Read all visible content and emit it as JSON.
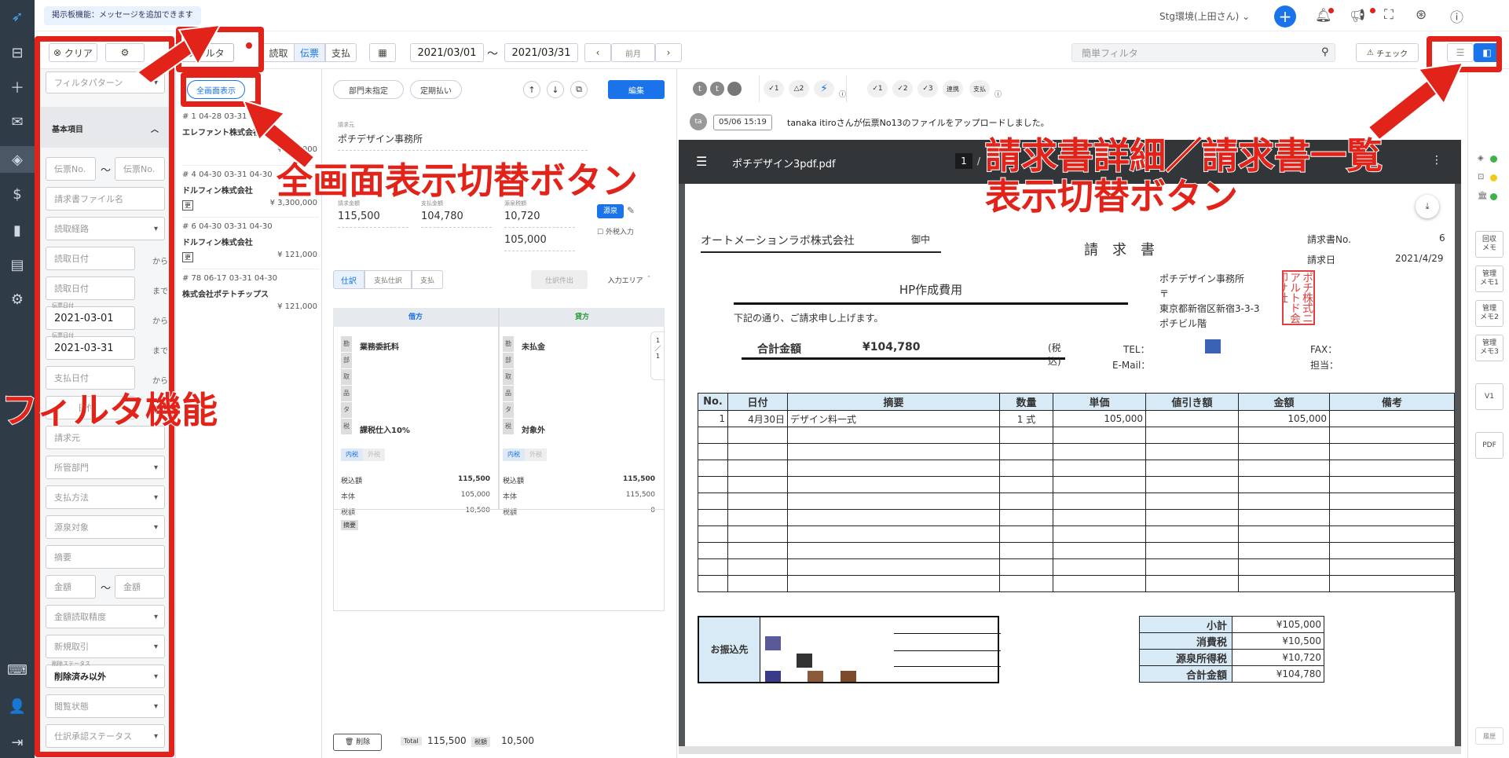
{
  "topbar": {
    "notice": "掲示板機能：メッセージを追加できます",
    "user": "Stg環境(上田さん) ⌄"
  },
  "toolbar": {
    "clear": "クリア",
    "filter": "フィルタ",
    "tab_read": "読取",
    "tab_voucher": "伝票",
    "tab_pay": "支払",
    "date_from": "2021/03/01",
    "date_sep": "〜",
    "date_to": "2021/03/31",
    "prev_month": "前月",
    "quick_filter_placeholder": "簡単フィルタ",
    "check": "チェック"
  },
  "filters": {
    "pattern": "フィルタパターン",
    "section": "基本項目",
    "voucher_no_a": "伝票No.",
    "voucher_no_b": "伝票No.",
    "file_name": "請求書ファイル名",
    "route": "読取経路",
    "read_date_a": "読取日付",
    "read_date_b": "読取日付",
    "from": "から",
    "to": "まで",
    "voucher_date_label": "伝票日付",
    "voucher_date_a": "2021-03-01",
    "voucher_date_b": "2021-03-31",
    "pay_date_a": "支払日付",
    "pay_date_b_partial": "日付",
    "biller": "請求元",
    "dept": "所管部門",
    "pay_method": "支払方法",
    "withholding": "源泉対象",
    "summary": "摘要",
    "amount_a": "金額",
    "amount_b": "金額",
    "accuracy": "金額読取精度",
    "new_trade": "新規取引",
    "delete_status_label": "削除ステータス",
    "delete_status": "削除済み以外",
    "view_state": "閲覧状態",
    "approval": "仕訳承認ステータス"
  },
  "list": {
    "fullscreen": "全画面表示",
    "items": [
      {
        "meta": "# 1   04-28   03-31   04-30",
        "name": "エレファント株式会社",
        "amount": "¥ 165,000"
      },
      {
        "meta": "# 4   04-30   03-31   04-30",
        "name": "ドルフィン株式会社",
        "tag": "更",
        "amount": "¥ 3,300,000"
      },
      {
        "meta": "# 6   04-30   03-31   04-30",
        "name": "ドルフィン株式会社",
        "tag": "更",
        "amount": "¥ 121,000"
      },
      {
        "meta": "# 78   06-17   03-31   04-30",
        "name": "株式会社ポテトチップス",
        "amount": "¥ 121,000"
      }
    ]
  },
  "entry": {
    "dept_unset": "部門未指定",
    "regular": "定期払い",
    "save": "編集",
    "biller_label": "請求元",
    "biller": "ポチデザイン事務所",
    "billed_label": "請求金額",
    "billed": "115,500",
    "paid_label": "支払金額",
    "paid": "104,780",
    "wh_label": "源泉税額",
    "wh": "10,720",
    "wh_base": "105,000",
    "wh_badge": "源泉",
    "tax_exempt": "外税入力",
    "tab_journal": "仕訳",
    "tab_pay_journal": "支払仕訳",
    "tab_pay": "支払",
    "journal_out": "仕訳件出",
    "input_area": "入力エリア ＾",
    "debit": "借方",
    "credit": "貸方",
    "row_labels": [
      "勘",
      "部",
      "取",
      "品",
      "タ",
      "税"
    ],
    "debit_account": "業務委託料",
    "debit_tax": "課税仕入10%",
    "credit_account": "未払金",
    "credit_tax": "対象外",
    "inner_tax": "内税",
    "outer_tax": "外税",
    "incl_label": "税込額",
    "base_label": "本体",
    "tax_label": "税額",
    "debit_incl": "115,500",
    "debit_base": "105,000",
    "debit_tax_amt": "10,500",
    "credit_incl": "115,500",
    "credit_base": "115,500",
    "credit_tax_amt": "0",
    "memo": "摘要",
    "delete": "削除",
    "total_label": "Total",
    "total": "115,500",
    "tax_tot_label": "税額",
    "tax_total": "10,500",
    "side_numbers": "1\n／\n1"
  },
  "viewer": {
    "badges1": [
      "1",
      "2"
    ],
    "badges2": [
      "1",
      "2",
      "3"
    ],
    "linked": "連携",
    "pay": "支払",
    "avatar": "ta",
    "log_time": "05/06 15:19",
    "log_msg": "tanaka itiroさんが伝票No13のファイルをアップロードしました。",
    "pdf_name": "ポチデザイン3pdf.pdf",
    "page": "1",
    "page_sep": "/"
  },
  "invoice": {
    "to_company": "オートメーションラボ株式会社",
    "honorific": "御中",
    "title": "請　求　書",
    "no_label": "請求書No.",
    "no": "6",
    "date_label": "請求日",
    "date": "2021/4/29",
    "subject": "HP作成費用",
    "intro": "下記の通り、ご請求申し上げます。",
    "total_label": "合計金額",
    "total": "¥104,780",
    "tax_note": "(税込)",
    "from_name": "ポチデザイン事務所",
    "postal": "〒",
    "address": "東京都新宿区新宿3-3-3",
    "building": "ポチビル階",
    "tel": "TEL：",
    "fax": "FAX：",
    "email": "E-Mail：",
    "contact": "担当：",
    "seal": "ポチ株式ニアルトド会印サ社",
    "headers": [
      "No.",
      "日付",
      "摘要",
      "数量",
      "単価",
      "値引き額",
      "金額",
      "備考"
    ],
    "row1": [
      "1",
      "4月30日",
      "デザイン料一式",
      "1 式",
      "105,000",
      "",
      "105,000",
      ""
    ],
    "bank_label": "お振込先",
    "subtotal_label": "小計",
    "subtotal": "¥105,000",
    "ctax_label": "消費税",
    "ctax": "¥10,500",
    "wh_label": "源泉所得税",
    "wh": "¥10,720",
    "grand_label": "合計金額",
    "grand": "¥104,780"
  },
  "rail": {
    "collect_memo": "回収\nメモ",
    "memo1": "管理\nメモ1",
    "memo2": "管理\nメモ2",
    "memo3": "管理\nメモ3",
    "v1": "V1",
    "pdf": "PDF",
    "history": "履歴"
  },
  "annotations": {
    "fullscreen_toggle": "全画面表示切替ボタン",
    "detail_list_toggle_1": "請求書詳細／請求書一覧",
    "detail_list_toggle_2": "表示切替ボタン",
    "filter_function": "フィルタ機能"
  },
  "colors": {
    "accent": "#1a73e8",
    "red": "#e2231a",
    "nav": "#2f3b47"
  }
}
